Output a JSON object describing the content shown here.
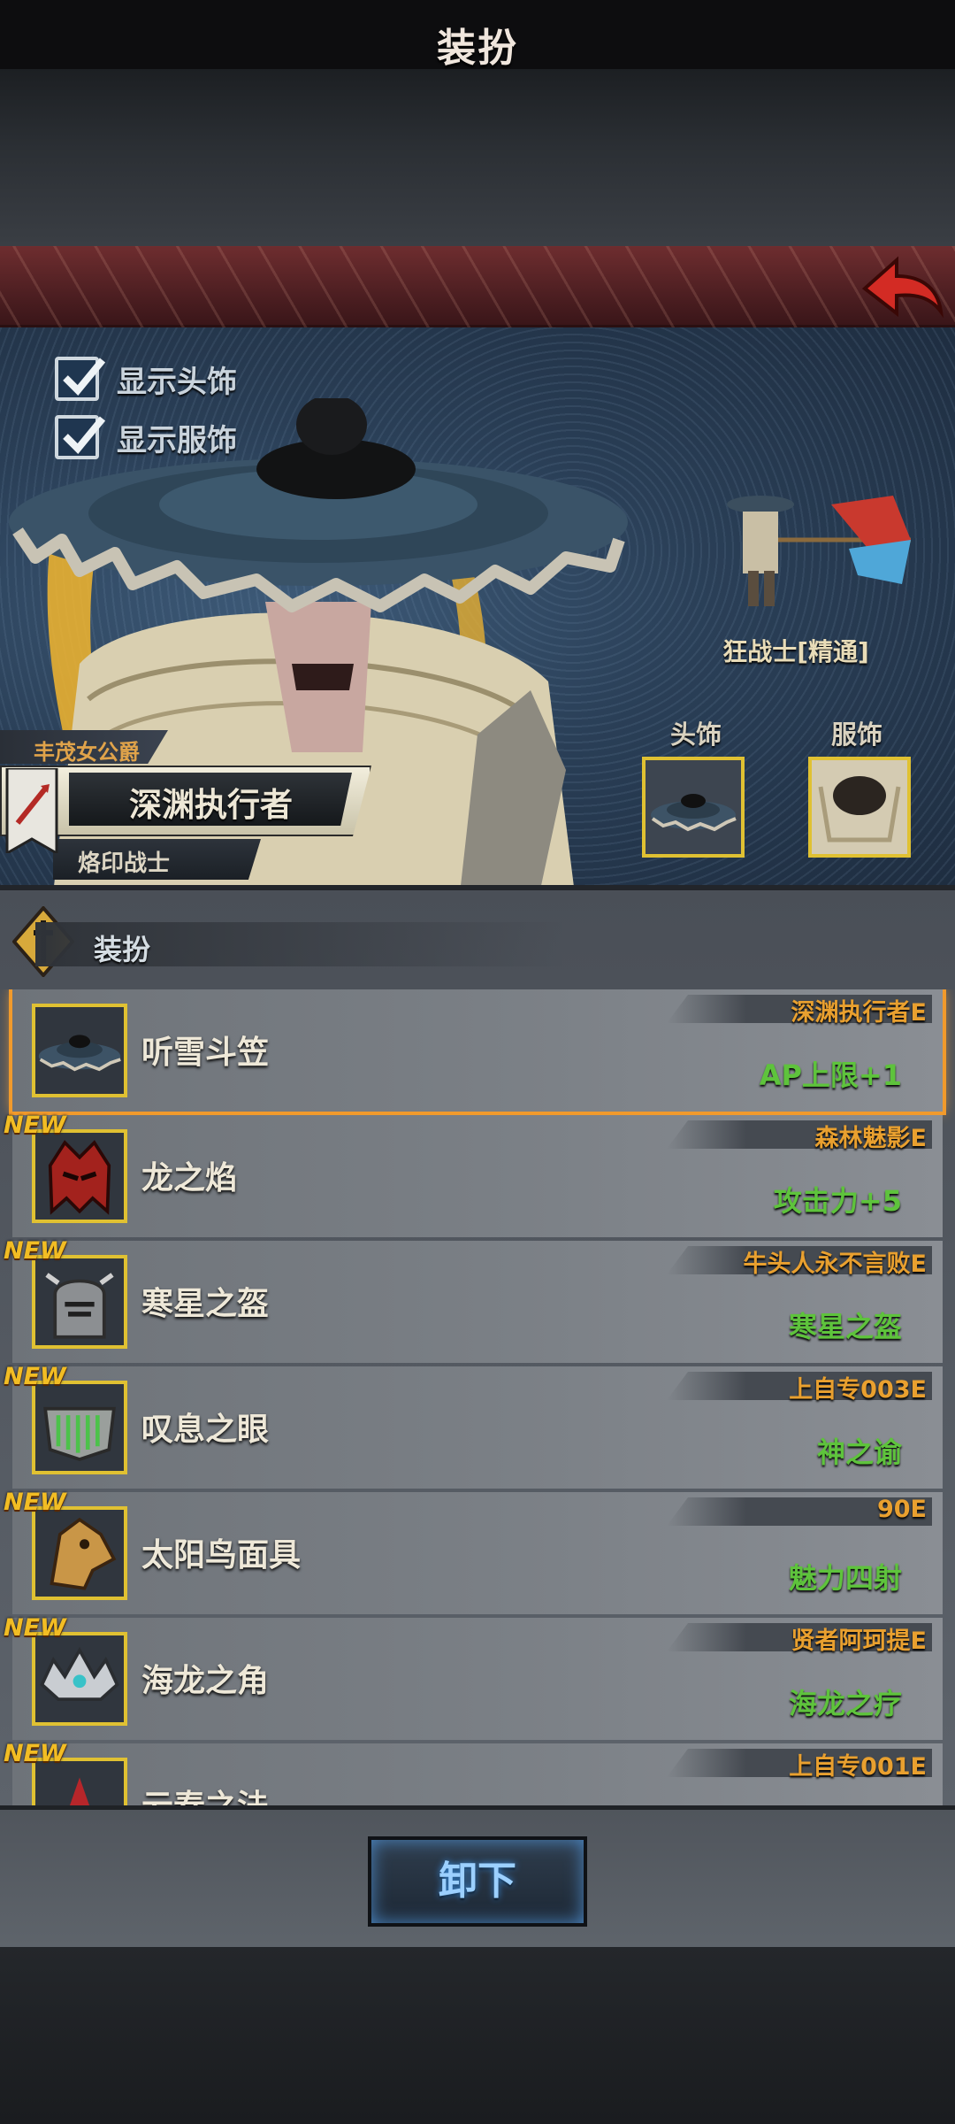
{
  "header": {
    "title": "装扮"
  },
  "options": {
    "show_headwear": "显示头饰",
    "show_outfit": "显示服饰"
  },
  "hero": {
    "nickname": "丰茂女公爵",
    "name": "深渊执行者",
    "rank": "烙印战士",
    "class_label": "狂战士[精通]",
    "slot_head": "头饰",
    "slot_outfit": "服饰"
  },
  "section": {
    "title": "装扮"
  },
  "items": [
    {
      "name": "听雪斗笠",
      "source": "深渊执行者E",
      "effect": "AP上限+1",
      "new": "",
      "selected": true,
      "icon": "straw-hat-icon"
    },
    {
      "name": "龙之焰",
      "source": "森林魅影E",
      "effect": "攻击力+5",
      "new": "NEW",
      "icon": "dragon-helm-icon"
    },
    {
      "name": "寒星之盔",
      "source": "牛头人永不言败E",
      "effect": "寒星之盔",
      "new": "NEW",
      "icon": "steel-helm-icon"
    },
    {
      "name": "叹息之眼",
      "source": "上自专003E",
      "effect": "神之谕",
      "new": "NEW",
      "icon": "green-mask-icon"
    },
    {
      "name": "太阳鸟面具",
      "source": "90E",
      "effect": "魅力四射",
      "new": "NEW",
      "icon": "bird-mask-icon"
    },
    {
      "name": "海龙之角",
      "source": "贤者阿珂提E",
      "effect": "海龙之疗",
      "new": "NEW",
      "icon": "sea-crown-icon"
    },
    {
      "name": "云春之法",
      "source": "上自专001E",
      "effect": "",
      "new": "NEW",
      "icon": "red-crest-icon"
    }
  ],
  "footer": {
    "unequip_label": "卸下"
  },
  "colors": {
    "accent_gold": "#e0c132",
    "source_orange": "#e9a02f",
    "effect_green": "#5ec33c",
    "title_red": "#6e2d2f"
  }
}
